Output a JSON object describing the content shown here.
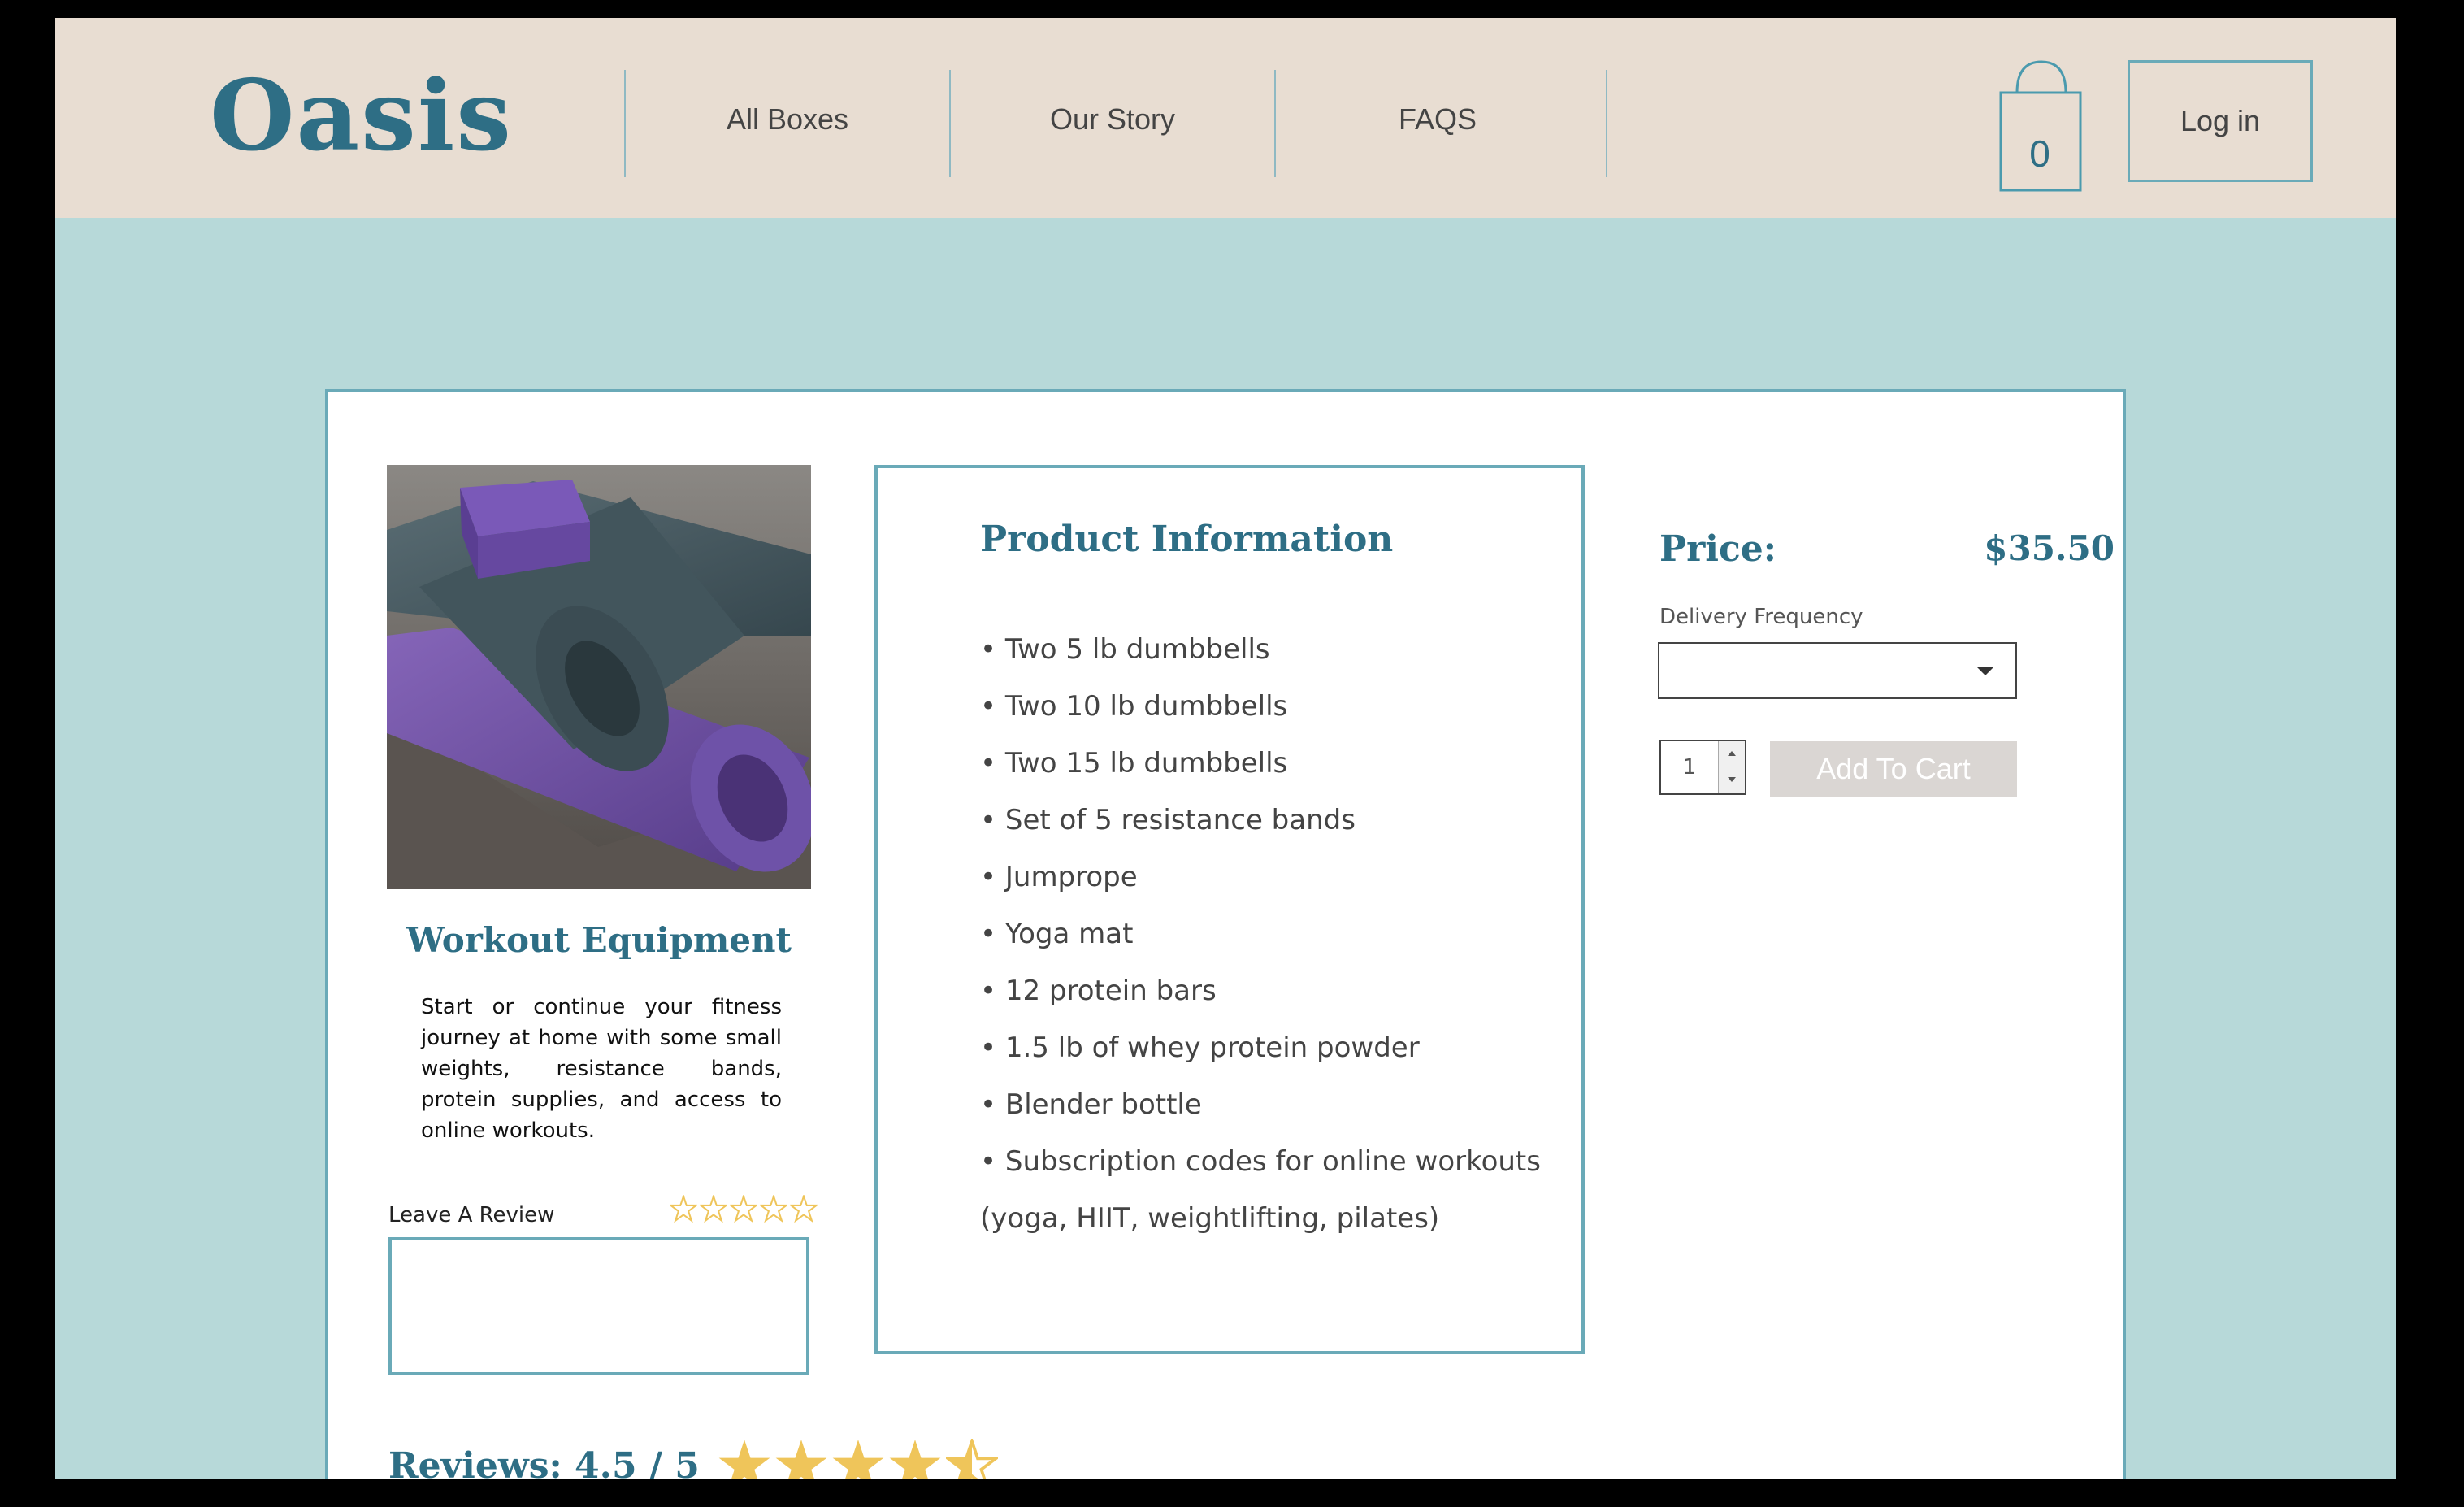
{
  "header": {
    "logo": "Oasis",
    "nav": [
      "All Boxes",
      "Our Story",
      "FAQS"
    ],
    "cart_count": "0",
    "login_label": "Log in"
  },
  "product": {
    "name": "Workout Equipment",
    "description": "Start or continue your fitness journey at home with some small weights, resistance bands, protein supplies, and access to online workouts.",
    "image_alt": "Rolled yoga mats with a yoga block"
  },
  "review": {
    "label": "Leave A Review",
    "star_count": 5,
    "text": ""
  },
  "info": {
    "title": "Product Information",
    "items": [
      "• Two 5 lb dumbbells",
      "• Two 10 lb dumbbells",
      "• Two 15 lb dumbbells",
      "• Set of 5 resistance bands",
      "• Jumprope",
      "• Yoga mat",
      "• 12 protein bars",
      "• 1.5 lb of whey protein powder",
      "• Blender bottle",
      "• Subscription codes for online workouts",
      "(yoga, HIIT, weightlifting, pilates)"
    ]
  },
  "purchase": {
    "price_label": "Price:",
    "price": "$35.50",
    "frequency_label": "Delivery Frequency",
    "frequency_value": "",
    "quantity": "1",
    "add_to_cart": "Add To Cart"
  },
  "reviews": {
    "title": "Reviews: 4.5 / 5",
    "rating": 4.5,
    "max": 5
  },
  "colors": {
    "brand": "#2e6e85",
    "accent_border": "#6aaab8",
    "header_bg": "#e8ddd2",
    "page_bg": "#b7d9d9",
    "star": "#efc55a"
  }
}
